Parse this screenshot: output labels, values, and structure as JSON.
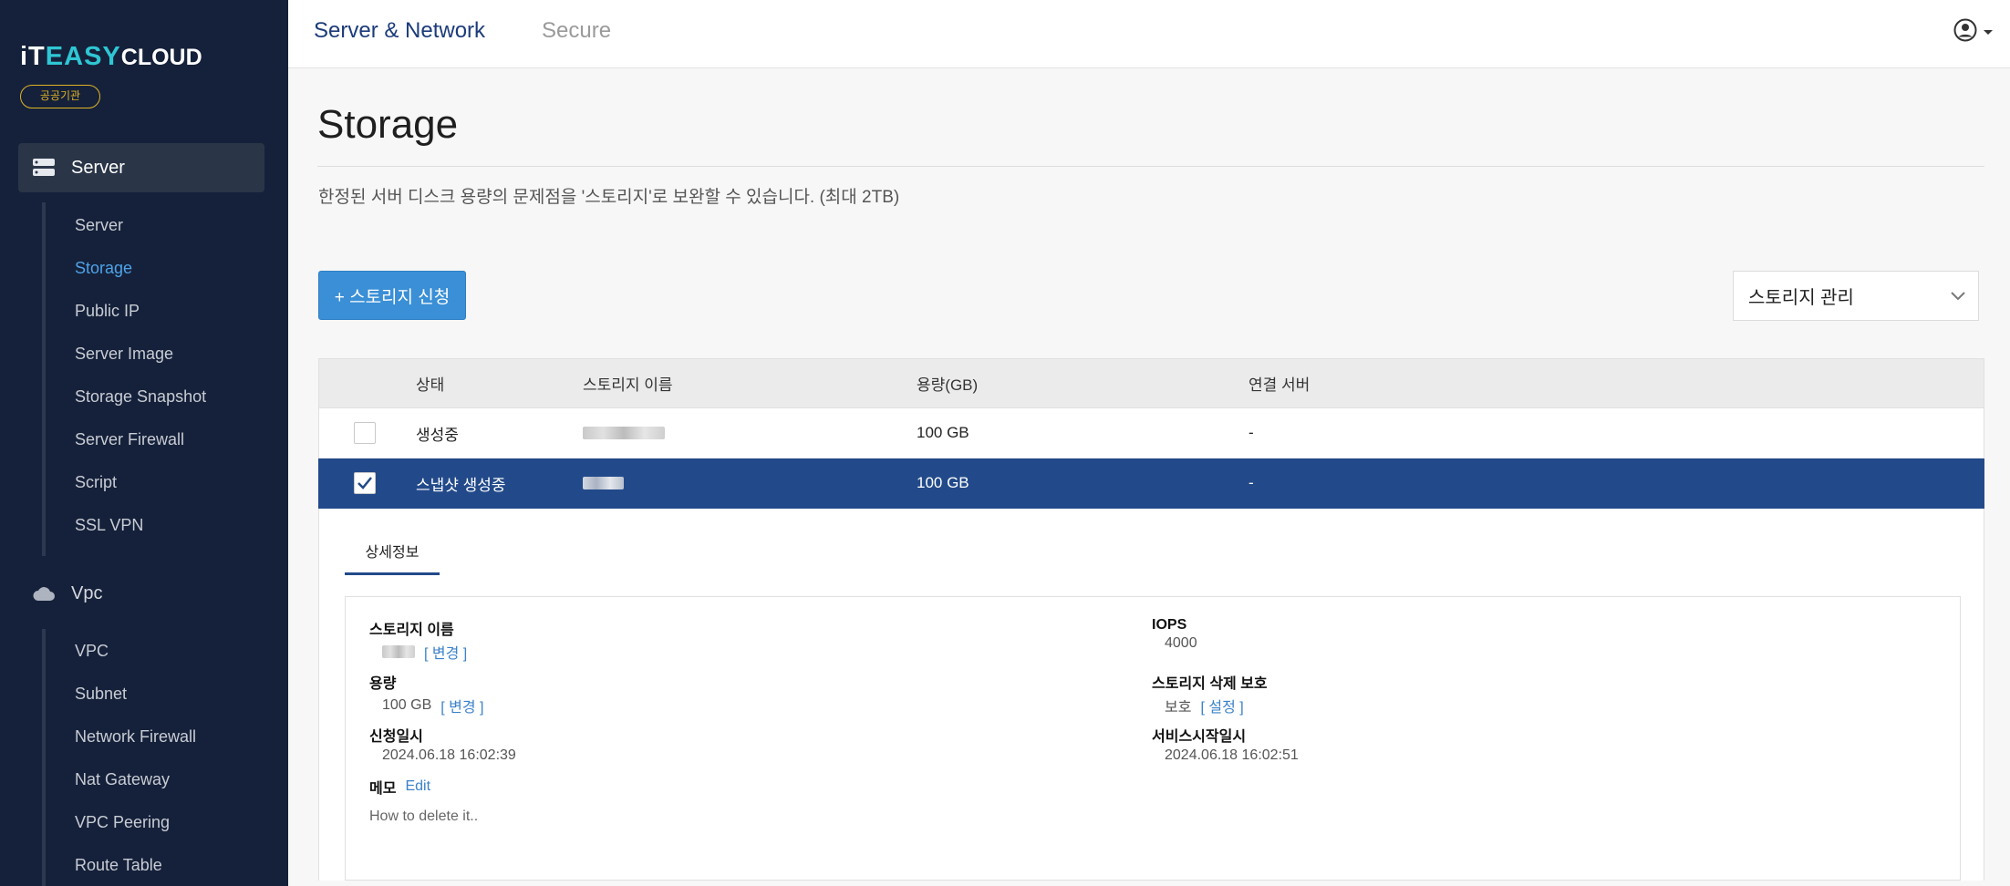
{
  "sidebar": {
    "logo": {
      "part1": "iT",
      "part2": "EASY",
      "part3": "CLOUD"
    },
    "badge": "공공기관",
    "groups": [
      {
        "label": "Server",
        "icon": "server-icon"
      },
      {
        "label": "Vpc",
        "icon": "cloud-icon"
      }
    ],
    "server_items": [
      "Server",
      "Storage",
      "Public IP",
      "Server Image",
      "Storage Snapshot",
      "Server Firewall",
      "Script",
      "SSL VPN"
    ],
    "vpc_items": [
      "VPC",
      "Subnet",
      "Network Firewall",
      "Nat Gateway",
      "VPC Peering",
      "Route Table"
    ],
    "current_item": "Storage"
  },
  "topbar": {
    "tabs": [
      {
        "label": "Server & Network",
        "active": true
      },
      {
        "label": "Secure",
        "active": false
      }
    ],
    "user_icon": "user-circle-icon"
  },
  "page": {
    "title": "Storage",
    "description": "한정된 서버 디스크 용량의 문제점을 '스토리지'로 보완할 수 있습니다. (최대 2TB)",
    "create_button": "+ 스토리지 신청",
    "manage_select": "스토리지 관리"
  },
  "table": {
    "headers": {
      "status": "상태",
      "name": "스토리지 이름",
      "size": "용량(GB)",
      "server": "연결 서버"
    },
    "rows": [
      {
        "checked": false,
        "status": "생성중",
        "size": "100 GB",
        "server": "-"
      },
      {
        "checked": true,
        "status": "스냅샷 생성중",
        "size": "100 GB",
        "server": "-"
      }
    ]
  },
  "detail": {
    "tab": "상세정보",
    "name_label": "스토리지 이름",
    "change_link": "[ 변경 ]",
    "size_label": "용량",
    "size_value": "100 GB",
    "size_link": "[ 변경 ]",
    "requested_label": "신청일시",
    "requested_value": "2024.06.18 16:02:39",
    "memo_label": "메모",
    "memo_edit": "Edit",
    "memo_text": "How to delete it..",
    "iops_label": "IOPS",
    "iops_value": "4000",
    "protect_label": "스토리지 삭제 보호",
    "protect_value": "보호",
    "protect_link": "[ 설정 ]",
    "start_label": "서비스시작일시",
    "start_value": "2024.06.18 16:02:51"
  },
  "colors": {
    "sidebar_bg": "#15213a",
    "accent_blue": "#3a8fd6",
    "selected_row": "#224a8a",
    "logo_teal": "#2fc6d4",
    "badge_gold": "#e0b325"
  }
}
